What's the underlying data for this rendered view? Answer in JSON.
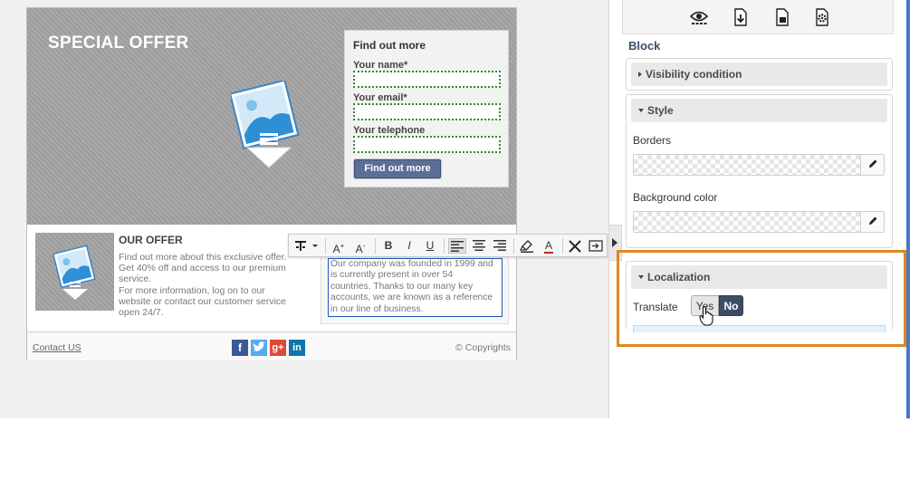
{
  "hero": {
    "title": "SPECIAL OFFER"
  },
  "form": {
    "title": "Find out more",
    "name_label": "Your name*",
    "email_label": "Your email*",
    "phone_label": "Your telephone",
    "button_label": "Find out more"
  },
  "offer": {
    "title": "OUR OFFER",
    "lines": [
      "Find out more about this exclusive offer.",
      "Get 40% off and access to our premium",
      "service.",
      "For more information, log on to our",
      "website or contact our customer service",
      "open 24/7."
    ]
  },
  "about": {
    "lines": [
      "Our company was founded in 1999 and",
      "is currently present in over 54",
      "countries. Thanks to our many key",
      "accounts, we are known as a reference",
      "in our line of business."
    ]
  },
  "footer": {
    "contact": "Contact US",
    "copyright": "© Copyrights"
  },
  "toolbar": {
    "bold": "B",
    "italic": "I",
    "underline": "U",
    "grow_font": "A",
    "grow_sup": "+",
    "shrink_font": "A",
    "shrink_sup": "-",
    "text_color": "A"
  },
  "panel": {
    "title": "Block",
    "visibility_label": "Visibility condition",
    "style_label": "Style",
    "borders_label": "Borders",
    "bg_color_label": "Background color",
    "localization_label": "Localization",
    "translate_label": "Translate",
    "yes_label": "Yes",
    "no_label": "No"
  },
  "icons": {
    "panel_tools": [
      "eye-icon",
      "page-arrow-icon",
      "page-icon",
      "page-gear-icon"
    ],
    "socials": [
      "facebook-icon",
      "twitter-icon",
      "google-plus-icon",
      "linkedin-icon"
    ],
    "edit": "pencil-icon"
  },
  "colors": {
    "accent_orange": "#e0871f",
    "button_blue": "#5a6e96",
    "toggle_dark": "#3e4d66",
    "facebook": "#3b5998",
    "twitter": "#55acee",
    "google_plus": "#dd4b39",
    "linkedin": "#0e76a8"
  }
}
